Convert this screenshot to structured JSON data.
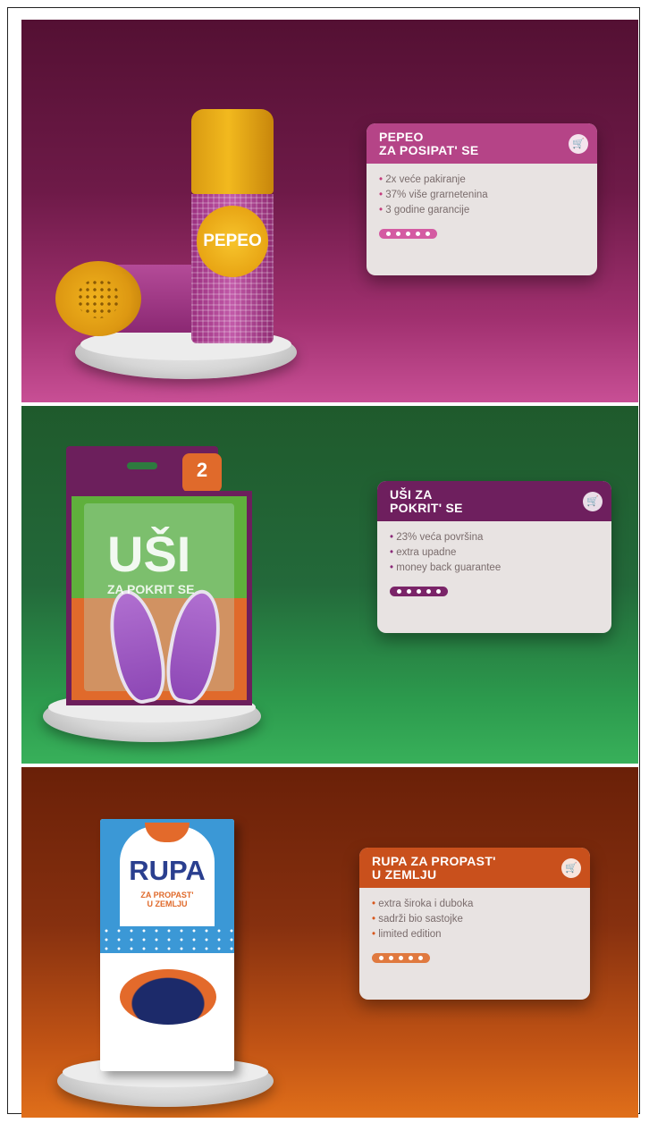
{
  "products": [
    {
      "id": "pepeo",
      "title_line1": "PEPEO",
      "title_line2": "ZA POSIPAT' SE",
      "features": [
        "2x veće pakiranje",
        "37% više grarnetenina",
        "3 godine garancije"
      ],
      "package_text": "PEPEO",
      "accent_color": "#b23c86",
      "head_color": "#b54487"
    },
    {
      "id": "usi",
      "title_line1": "UŠI ZA",
      "title_line2": "POKRIT' SE",
      "features": [
        "23% veća površina",
        "extra upadne",
        "money back guarantee"
      ],
      "package_text": "UŠI",
      "package_sub": "ZA POKRIT SE",
      "package_badge": "2",
      "accent_color": "#7a2468",
      "head_color": "#6e1f5e"
    },
    {
      "id": "rupa",
      "title_line1": "RUPA ZA PROPAST'",
      "title_line2": "U ZEMLJU",
      "features": [
        "extra široka i duboka",
        "sadrži bio sastojke",
        "limited edition"
      ],
      "package_text": "RUPA",
      "package_sub_line1": "ZA PROPAST'",
      "package_sub_line2": "U ZEMLJU",
      "accent_color": "#e06a2b",
      "head_color": "#c9501c"
    }
  ],
  "icons": {
    "cart": "shopping-cart-icon"
  }
}
